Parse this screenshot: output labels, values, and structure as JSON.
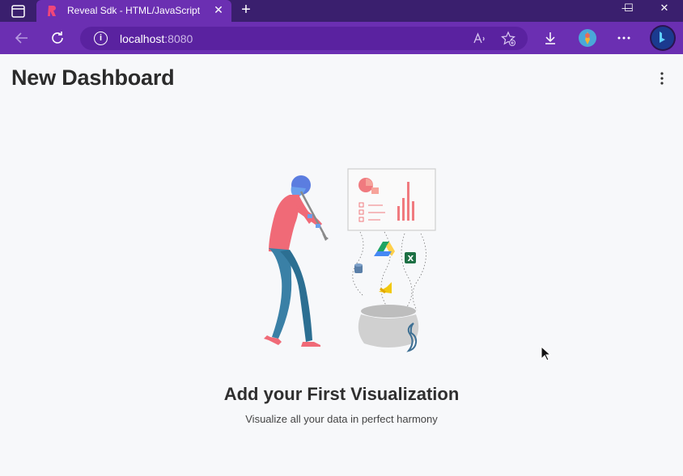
{
  "browser": {
    "tab_title": "Reveal Sdk - HTML/JavaScript",
    "tab_close": "✕",
    "new_tab": "+",
    "window_controls": {
      "minimize": "—",
      "maximize": "☐",
      "close": "✕"
    },
    "address": {
      "host": "localhost",
      "port": ":8080"
    },
    "icons": [
      "tab-actions-icon",
      "back-icon",
      "refresh-icon",
      "info-icon",
      "read-aloud-icon",
      "add-favorite-icon",
      "download-icon",
      "profile-icon",
      "more-icon",
      "bing-icon"
    ],
    "colors": {
      "titlebar": "#3a1f6e",
      "toolbar": "#6b2fb2"
    }
  },
  "dashboard": {
    "title": "New Dashboard",
    "empty_state": {
      "title": "Add your First Visualization",
      "subtitle": "Visualize all your data in perfect harmony"
    }
  }
}
